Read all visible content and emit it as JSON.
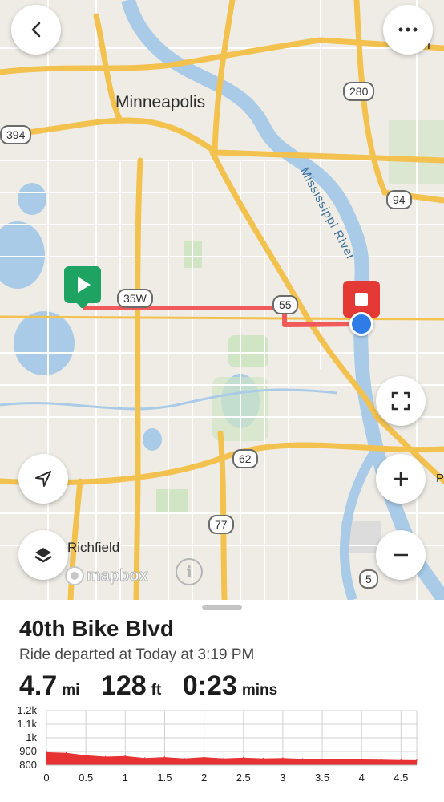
{
  "map": {
    "city_labels": {
      "minneapolis": "Minneapolis",
      "richfield": "Richfield",
      "edge": "on I"
    },
    "river_label": "Mississippi River",
    "shields": {
      "s394": "394",
      "s280": "280",
      "s94": "94",
      "s35w": "35W",
      "s55": "55",
      "s62": "62",
      "s77": "77",
      "s5": "5"
    },
    "attribution": "mapbox",
    "edge_letter": "P",
    "colors": {
      "water": "#a9cbe8",
      "park": "#cfe5c3",
      "highway": "#f2c14e",
      "route": "#f05a5a",
      "start_marker": "#1fa363",
      "end_marker": "#e53935",
      "location_dot": "#2f7be8"
    }
  },
  "controls": {
    "back_icon": "chevron-left-icon",
    "more_icon": "ellipsis-icon",
    "fullscreen_icon": "expand-icon",
    "locate_icon": "navigation-arrow-icon",
    "zoom_in_icon": "plus-icon",
    "zoom_out_icon": "minus-icon",
    "layers_icon": "layers-icon",
    "info_icon": "info-icon"
  },
  "ride": {
    "title": "40th Bike Blvd",
    "departed": "Ride departed at Today at 3:19 PM",
    "distance_value": "4.7",
    "distance_unit": "mi",
    "elevation_value": "128",
    "elevation_unit": "ft",
    "duration_value": "0:23",
    "duration_unit": "mins"
  },
  "chart_data": {
    "type": "area",
    "x": [
      0,
      0.25,
      0.5,
      0.75,
      1,
      1.25,
      1.5,
      1.75,
      2,
      2.25,
      2.5,
      2.75,
      3,
      3.25,
      3.5,
      3.75,
      4,
      4.25,
      4.5,
      4.7
    ],
    "y": [
      895,
      890,
      872,
      862,
      866,
      852,
      858,
      848,
      858,
      848,
      854,
      849,
      852,
      846,
      844,
      843,
      841,
      840,
      837,
      836
    ],
    "y_ticks": [
      "1.2k",
      "1.1k",
      "1k",
      "900",
      "800"
    ],
    "x_ticks": [
      "0",
      "0.5",
      "1",
      "1.5",
      "2",
      "2.5",
      "3",
      "3.5",
      "4",
      "4.5"
    ],
    "xlim": [
      0,
      4.7
    ],
    "ylim": [
      800,
      1200
    ],
    "grid": true,
    "color": "#e63232"
  }
}
